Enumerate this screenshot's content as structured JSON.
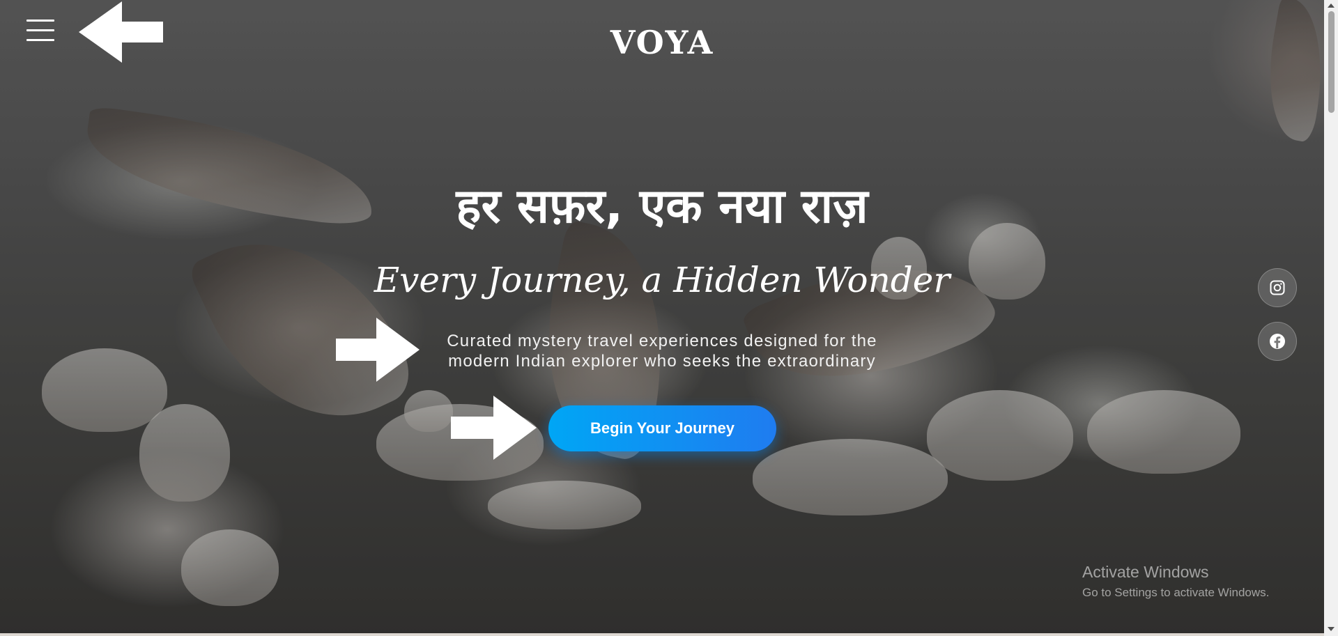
{
  "header": {
    "brand": "VOYA",
    "menu_icon": "hamburger-menu-icon"
  },
  "hero": {
    "title": "हर सफ़र, एक नया राज़",
    "subtitle": "Every Journey, a Hidden Wonder",
    "description_line1": "Curated mystery travel experiences designed for the",
    "description_line2": "modern Indian explorer who seeks the extraordinary",
    "cta_label": "Begin Your Journey"
  },
  "social": {
    "instagram_icon": "instagram-icon",
    "facebook_icon": "facebook-icon"
  },
  "watermark": {
    "title": "Activate Windows",
    "subtitle": "Go to Settings to activate Windows."
  },
  "colors": {
    "cta_start": "#00a6f5",
    "cta_end": "#1f7cf0",
    "text": "#ffffff"
  }
}
